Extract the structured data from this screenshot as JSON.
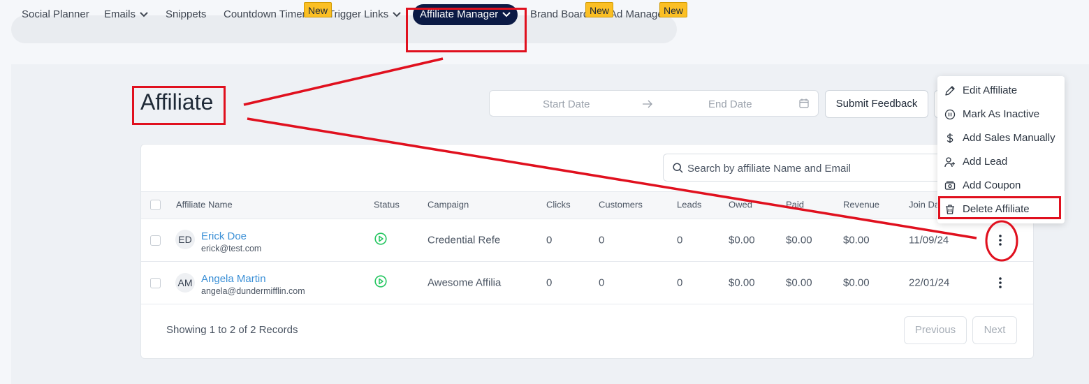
{
  "nav": {
    "items": [
      {
        "label": "Social Planner"
      },
      {
        "label": "Emails"
      },
      {
        "label": "Snippets"
      },
      {
        "label": "Countdown Timers"
      },
      {
        "label": "Trigger Links"
      },
      {
        "label": "Affiliate Manager"
      },
      {
        "label": "Brand Boards"
      },
      {
        "label": "Ad Manager"
      }
    ],
    "new_badge": "New"
  },
  "page": {
    "title": "Affiliate",
    "start_date_placeholder": "Start Date",
    "end_date_placeholder": "End Date",
    "submit_feedback": "Submit Feedback"
  },
  "search": {
    "placeholder": "Search by affiliate Name and Email"
  },
  "table": {
    "columns": [
      "Affiliate Name",
      "Status",
      "Campaign",
      "Clicks",
      "Customers",
      "Leads",
      "Owed",
      "Paid",
      "Revenue",
      "Join Da"
    ],
    "rows": [
      {
        "initials": "ED",
        "name": "Erick Doe",
        "email": "erick@test.com",
        "campaign": "Credential Refe",
        "clicks": "0",
        "customers": "0",
        "leads": "0",
        "owed": "$0.00",
        "paid": "$0.00",
        "revenue": "$0.00",
        "join_date": "11/09/24"
      },
      {
        "initials": "AM",
        "name": "Angela Martin",
        "email": "angela@dundermifflin.com",
        "campaign": "Awesome Affilia",
        "clicks": "0",
        "customers": "0",
        "leads": "0",
        "owed": "$0.00",
        "paid": "$0.00",
        "revenue": "$0.00",
        "join_date": "22/01/24"
      }
    ]
  },
  "pagination": {
    "summary": "Showing 1 to 2 of 2 Records",
    "previous": "Previous",
    "next": "Next"
  },
  "row_menu": {
    "items": [
      {
        "label": "Edit Affiliate",
        "icon": "pencil-icon"
      },
      {
        "label": "Mark As Inactive",
        "icon": "pause-circle-icon"
      },
      {
        "label": "Add Sales Manually",
        "icon": "dollar-icon"
      },
      {
        "label": "Add Lead",
        "icon": "user-plus-icon"
      },
      {
        "label": "Add Coupon",
        "icon": "coupon-icon"
      },
      {
        "label": "Delete Affiliate",
        "icon": "trash-icon"
      }
    ]
  },
  "colors": {
    "accent": "#0b1a45",
    "link": "#3a8fd6",
    "status_active": "#22c55e",
    "new_badge": "#fbbf24",
    "annotation": "#e0101e"
  }
}
